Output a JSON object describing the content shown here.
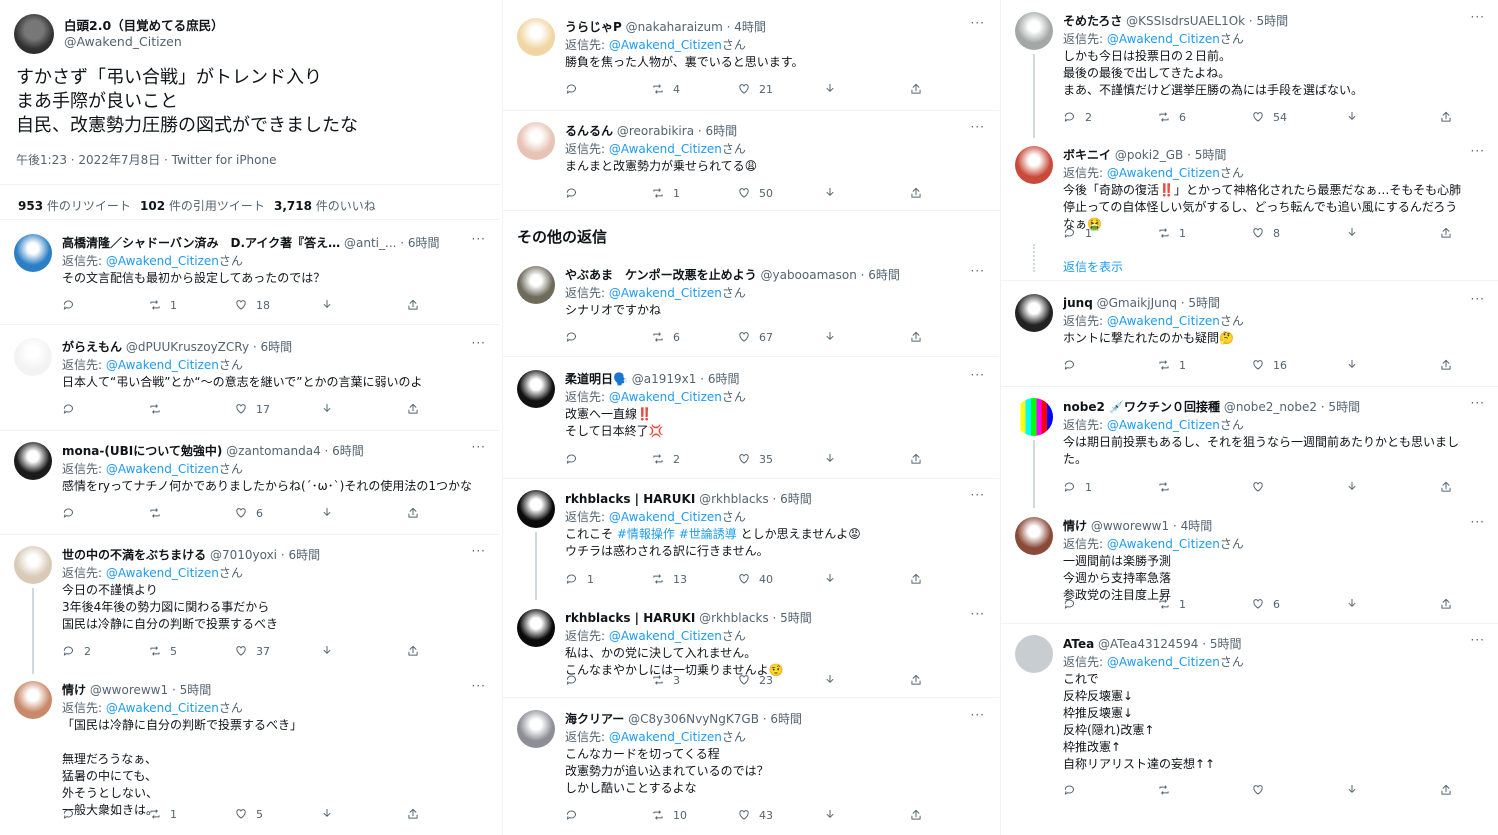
{
  "main_tweet": {
    "name": "白頭2.0（目覚めてる庶民）",
    "handle": "@Awakend_Citizen",
    "lines": [
      "すかさず「弔い合戦」がトレンド入り",
      "まあ手際が良いこと",
      "自民、改憲勢力圧勝の図式ができましたな"
    ],
    "meta": "午後1:23 · 2022年7月8日 · Twitter for iPhone",
    "retweets_count": "953",
    "retweets_label": "件のリツイート",
    "quotes_count": "102",
    "quotes_label": "件の引用ツイート",
    "likes_count": "3,718",
    "likes_label": "件のいいね"
  },
  "reply_prefix": "返信先: ",
  "reply_mention": "@Awakend_Citizen",
  "reply_suffix": "さん",
  "more_label": "···",
  "section_title": "その他の返信",
  "show_replies": "返信を表示",
  "col1": [
    {
      "name": "高橋清隆／シャドーバン済み　D.アイク著『答え…",
      "handle": "@anti_... · 6時間",
      "lines": [
        "その文言配信も最初から設定してあったのでは？"
      ],
      "reply": "",
      "retweet": "1",
      "like": "18"
    },
    {
      "name": "がらえもん",
      "handle": "@dPUUKruszoyZCRy · 6時間",
      "lines": [
        "日本人て“弔い合戦”とか“〜の意志を継いで”とかの言葉に弱いのよ"
      ],
      "reply": "",
      "retweet": "",
      "like": "17"
    },
    {
      "name": "mona-(UBIについて勉強中)",
      "handle": "@zantomanda4 · 6時間",
      "lines": [
        "感情をryってナチノ何かでありましたからね(´･ω･`)それの使用法の1つかな"
      ],
      "reply": "",
      "retweet": "",
      "like": "6"
    },
    {
      "name": "世の中の不満をぶちまける",
      "handle": "@7010yoxi · 6時間",
      "lines": [
        "今日の不謹慎より",
        "3年後4年後の勢力図に関わる事だから",
        "国民は冷静に自分の判断で投票するべき"
      ],
      "reply": "2",
      "retweet": "5",
      "like": "37"
    },
    {
      "name": "情け",
      "handle": "@wworeww1 · 5時間",
      "lines": [
        "「国民は冷静に自分の判断で投票するべき」",
        "",
        "無理だろうなぁ、",
        "猛暑の中にても、",
        "外そうとしない、",
        "一般大衆如きは。"
      ],
      "reply": "",
      "retweet": "1",
      "like": "5"
    }
  ],
  "col2": [
    {
      "name": "うらじゃP",
      "handle": "@nakaharaizum · 4時間",
      "lines": [
        "勝負を焦った人物が、裏でいると思います。"
      ],
      "reply": "",
      "retweet": "4",
      "like": "21"
    },
    {
      "name": "るんるん",
      "handle": "@reorabikira · 6時間",
      "lines": [
        "まんまと改憲勢力が乗せられてる😩"
      ],
      "reply": "",
      "retweet": "1",
      "like": "50"
    },
    {
      "name": "やぶあま　ケンポー改悪を止めよう",
      "handle": "@yabooamason · 6時間",
      "lines": [
        "シナリオですかね"
      ],
      "reply": "",
      "retweet": "6",
      "like": "67"
    },
    {
      "name": "柔道明日🗣️",
      "handle": "@a1919x1 · 6時間",
      "lines": [
        "改憲へ一直線‼️",
        "そして日本終了💢"
      ],
      "reply": "",
      "retweet": "2",
      "like": "35"
    },
    {
      "name": "rkhblacks | HARUKI",
      "handle": "@rkhblacks · 6時間",
      "lines": [
        "これこそ #情報操作 #世論誘導 としか思えませんよ😡",
        "ウチラは惑わされる訳に行きません。"
      ],
      "reply": "1",
      "retweet": "13",
      "like": "40"
    },
    {
      "name": "rkhblacks | HARUKI",
      "handle": "@rkhblacks · 5時間",
      "lines": [
        "私は、かの党に決して入れません。",
        "こんなまやかしには一切乗りませんよ🤨"
      ],
      "reply": "",
      "retweet": "3",
      "like": "23"
    },
    {
      "name": "海クリアー",
      "handle": "@C8y306NvyNgK7GB · 6時間",
      "lines": [
        "こんなカードを切ってくる程",
        "改憲勢力が追い込まれているのでは？",
        "しかし酷いことするよな"
      ],
      "reply": "",
      "retweet": "10",
      "like": "43"
    }
  ],
  "col3": [
    {
      "name": "そめたろさ",
      "handle": "@KSSIsdrsUAEL1Ok · 5時間",
      "lines": [
        "しかも今日は投票日の２日前。",
        "最後の最後で出してきたよね。",
        "まあ、不謹慎だけど選挙圧勝の為には手段を選ばない。"
      ],
      "reply": "2",
      "retweet": "6",
      "like": "54"
    },
    {
      "name": "ボキニイ",
      "handle": "@poki2_GB · 5時間",
      "lines": [
        "今後「奇跡の復活‼️」とかって神格化されたら最悪だなぁ…そもそも心肺",
        "停止っての自体怪しい気がするし、どっち転んでも追い風にするんだろう",
        "なぁ🤮"
      ],
      "reply": "1",
      "retweet": "1",
      "like": "8"
    },
    {
      "name": "junq",
      "handle": "@GmaikjJunq · 5時間",
      "lines": [
        "ホントに撃たれたのかも疑問🤔"
      ],
      "reply": "",
      "retweet": "1",
      "like": "16"
    },
    {
      "name": "nobe2 💉ワクチン０回接種",
      "handle": "@nobe2_nobe2 · 5時間",
      "lines": [
        "今は期日前投票もあるし、それを狙うなら一週間前あたりかとも思いまし",
        "た。"
      ],
      "reply": "1",
      "retweet": "",
      "like": ""
    },
    {
      "name": "情け",
      "handle": "@wworeww1 · 4時間",
      "lines": [
        "一週間前は楽勝予測",
        "今週から支持率急落",
        "参政党の注目度上昇"
      ],
      "reply": "",
      "retweet": "1",
      "like": "6"
    },
    {
      "name": "ATea",
      "handle": "@ATea43124594 · 5時間",
      "lines": [
        "これで",
        "反枠反壊憲↓",
        "枠推反壊憲↓",
        "反枠(隠れ)改憲↑",
        "枠推改憲↑",
        "自称リアリスト達の妄想↑↑"
      ],
      "reply": "",
      "retweet": "",
      "like": ""
    }
  ]
}
